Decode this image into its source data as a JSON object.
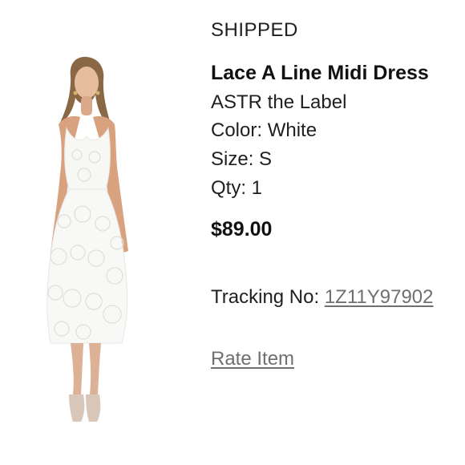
{
  "order_item": {
    "status": "SHIPPED",
    "product_name": "Lace A Line Midi Dress",
    "brand": "ASTR the Label",
    "color": "Color: White",
    "size": "Size: S",
    "qty": "Qty: 1",
    "price": "$89.00",
    "tracking_label": "Tracking No: ",
    "tracking_number": "1Z11Y97902",
    "rate_item_label": "Rate Item",
    "image_icon": "white-lace-midi-dress-photo"
  },
  "colors": {
    "text": "#1f1f1f",
    "link": "#6f6f6f",
    "background": "#ffffff"
  }
}
